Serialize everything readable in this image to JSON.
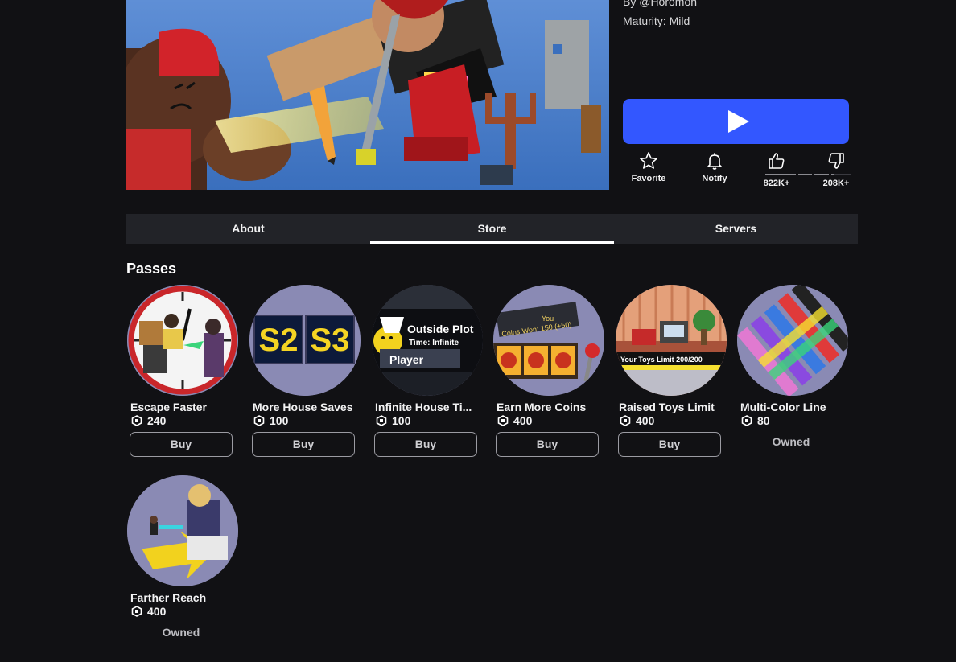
{
  "meta": {
    "creator": "By @Horomon",
    "maturity": "Maturity: Mild"
  },
  "actions": {
    "favorite": "Favorite",
    "notify": "Notify",
    "upvotes": "822K+",
    "downvotes": "208K+",
    "upvote_ratio": 0.8
  },
  "tabs": [
    "About",
    "Store",
    "Servers"
  ],
  "active_tab": "Store",
  "section_title": "Passes",
  "passes": [
    {
      "name": "Escape Faster",
      "price": "240",
      "action": "Buy",
      "icon": "clock-icon"
    },
    {
      "name": "More House Saves",
      "price": "100",
      "action": "Buy",
      "icon": "save-slots-icon"
    },
    {
      "name": "Infinite House Ti...",
      "price": "100",
      "action": "Buy",
      "icon": "outside-plot-icon"
    },
    {
      "name": "Earn More Coins",
      "price": "400",
      "action": "Buy",
      "icon": "slot-machine-icon"
    },
    {
      "name": "Raised Toys Limit",
      "price": "400",
      "action": "Buy",
      "icon": "toy-room-icon"
    },
    {
      "name": "Multi-Color Line",
      "price": "80",
      "action": "Owned",
      "icon": "color-pens-icon"
    },
    {
      "name": "Farther Reach",
      "price": "400",
      "action": "Owned",
      "icon": "reach-arrow-icon"
    }
  ],
  "thumb_text": {
    "s2": "S2",
    "s3": "S3",
    "outside_plot": "Outside Plot",
    "time": "Time: Infinite",
    "player": "Player",
    "you": "You",
    "coins_won": "Coins Won: 150 (+50)",
    "toys_limit": "Your Toys Limit 200/200"
  },
  "colors": {
    "play_button": "#3357ff",
    "background": "#111114",
    "tab_bar": "#222328"
  }
}
